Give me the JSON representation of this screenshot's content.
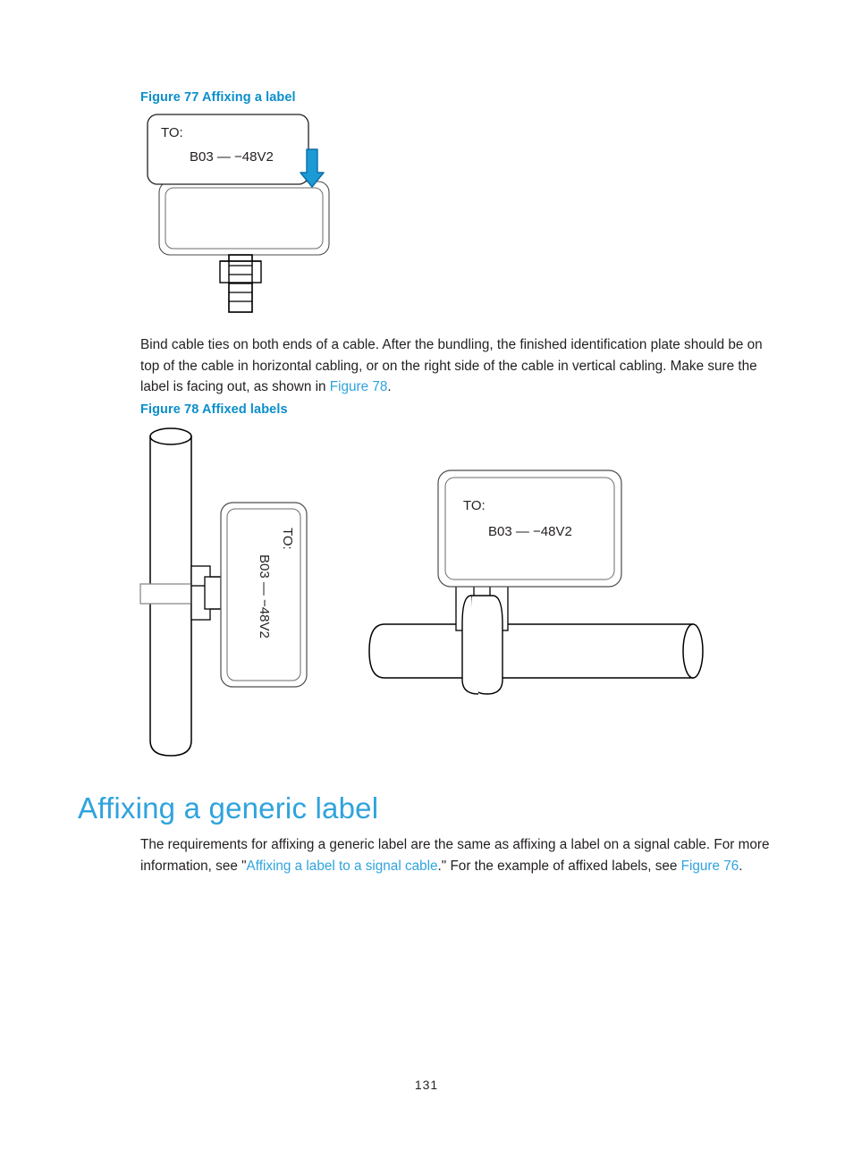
{
  "document": {
    "page_number": "131"
  },
  "figure77": {
    "caption": "Figure 77 Affixing a label",
    "label": {
      "line1": "TO:",
      "line2": "B03  —  −48V2"
    },
    "arrow_color": "#1b9ad6",
    "arrow_name": "downward-arrow"
  },
  "paragraph1": {
    "part1": "Bind cable ties on both ends of a cable. After the bundling, the finished identification plate should be on top of the cable in horizontal cabling, or on the right side of the cable in vertical cabling. Make sure the label is facing out, as shown in ",
    "link": "Figure 78",
    "part2": "."
  },
  "figure78": {
    "caption": "Figure 78 Affixed labels",
    "vertical_label": {
      "line1": "TO:",
      "line2": "B03  —  −48V2"
    },
    "horizontal_label": {
      "line1": "TO:",
      "line2": "B03 —    −48V2"
    }
  },
  "section": {
    "heading": "Affixing a generic label",
    "paragraph": {
      "part1": "The requirements for affixing a generic label are the same as affixing a label on a signal cable. For more information, see \"",
      "link1": "Affixing a label to a signal cable",
      "part2": ".\" For the example of affixed labels, see ",
      "link2": "Figure 76",
      "part3": "."
    }
  },
  "colors": {
    "heading_blue": "#2fa3dd",
    "caption_blue": "#0b8ecb",
    "link_blue": "#2fa3dd",
    "ink": "#231f20"
  }
}
